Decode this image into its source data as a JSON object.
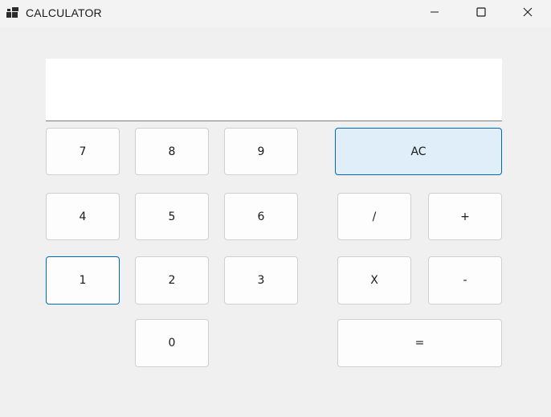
{
  "window": {
    "title": "CALCULATOR"
  },
  "titlebar": {
    "app_icon": "calculator-app-icon",
    "minimize_icon": "minimize-icon",
    "maximize_icon": "maximize-icon",
    "close_icon": "close-icon"
  },
  "display": {
    "value": ""
  },
  "buttons": {
    "seven": "7",
    "eight": "8",
    "nine": "9",
    "clear": "AC",
    "four": "4",
    "five": "5",
    "six": "6",
    "divide": "/",
    "plus": "+",
    "one": "1",
    "two": "2",
    "three": "3",
    "multiply": "X",
    "minus": "-",
    "zero": "0",
    "equals": "="
  },
  "colors": {
    "accent": "#0067c0",
    "accent_fill": "#e0eef9",
    "background": "#f0f0f0"
  }
}
